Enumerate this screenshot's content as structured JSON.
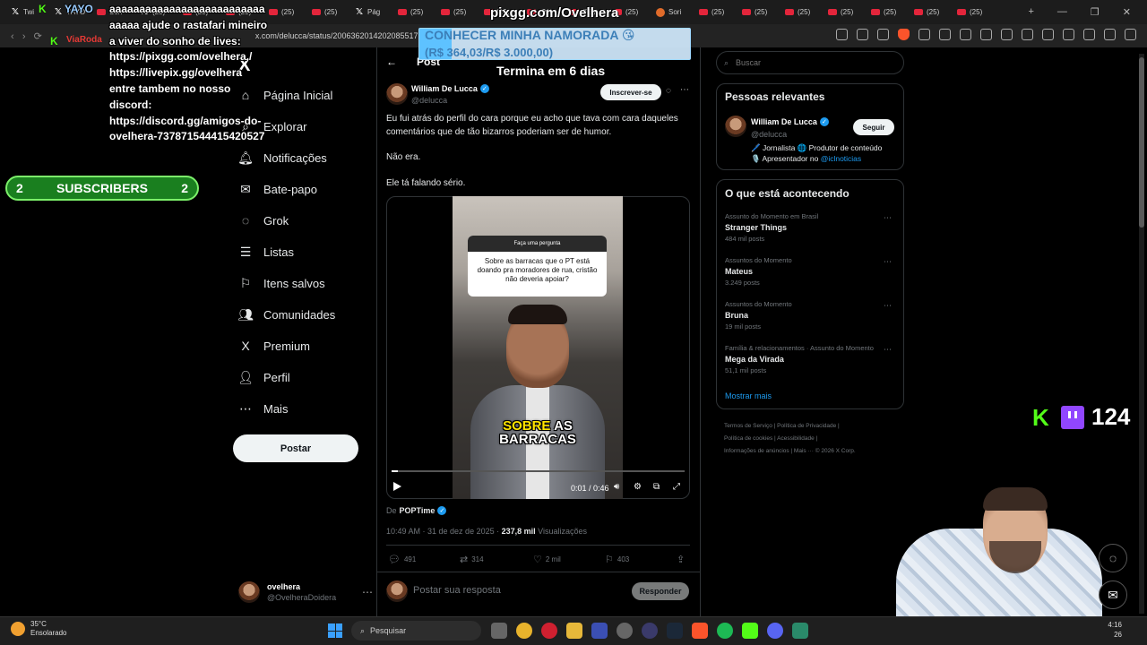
{
  "browser": {
    "tabs": [
      {
        "label": "Twi",
        "icon": "x"
      },
      {
        "label": "YAYO",
        "icon": "x"
      },
      {
        "label": "Sori",
        "icon": "yt"
      },
      {
        "label": "(25)",
        "icon": "x"
      },
      {
        "label": "(25)",
        "icon": "yt"
      },
      {
        "label": "(25)",
        "icon": "yt"
      },
      {
        "label": "(25)",
        "icon": "yt"
      },
      {
        "label": "(25)",
        "icon": "yt"
      },
      {
        "label": "Pág",
        "icon": "x"
      },
      {
        "label": "(25)",
        "icon": "yt"
      },
      {
        "label": "(25)",
        "icon": "yt"
      },
      {
        "label": "(25)",
        "icon": "yt"
      },
      {
        "label": "(25)",
        "icon": "yt"
      },
      {
        "label": "(25)",
        "icon": "yt"
      },
      {
        "label": "(25)",
        "icon": "yt"
      },
      {
        "label": "Sori",
        "icon": "s"
      },
      {
        "label": "(25)",
        "icon": "yt"
      },
      {
        "label": "(25)",
        "icon": "yt"
      },
      {
        "label": "(25)",
        "icon": "yt"
      },
      {
        "label": "(25)",
        "icon": "yt"
      },
      {
        "label": "(25)",
        "icon": "yt"
      },
      {
        "label": "(25)",
        "icon": "yt"
      },
      {
        "label": "(25)",
        "icon": "yt"
      }
    ],
    "url": "x.com/delucca/status/2006362014202085517"
  },
  "nav": {
    "logo": "X",
    "items": [
      {
        "label": "Página Inicial",
        "icon": "⌂",
        "name": "home"
      },
      {
        "label": "Explorar",
        "icon": "⌕",
        "name": "explore"
      },
      {
        "label": "Notificações",
        "icon": "🔔︎",
        "name": "notifications"
      },
      {
        "label": "Bate-papo",
        "icon": "✉",
        "name": "chat"
      },
      {
        "label": "Grok",
        "icon": "◌",
        "name": "grok"
      },
      {
        "label": "Listas",
        "icon": "☰",
        "name": "lists"
      },
      {
        "label": "Itens salvos",
        "icon": "⚐",
        "name": "bookmarks"
      },
      {
        "label": "Comunidades",
        "icon": "👥︎",
        "name": "communities"
      },
      {
        "label": "Premium",
        "icon": "X",
        "name": "premium"
      },
      {
        "label": "Perfil",
        "icon": "👤︎",
        "name": "profile"
      },
      {
        "label": "Mais",
        "icon": "⋯",
        "name": "more"
      }
    ],
    "post_button": "Postar",
    "account": {
      "name": "ovelhera",
      "handle": "@OvelheraDoidera"
    }
  },
  "post": {
    "header": "Post",
    "author": {
      "name": "William De Lucca",
      "handle": "@delucca"
    },
    "subscribe_button": "Inscrever-se",
    "paragraphs": [
      "Eu fui atrás do perfil do cara porque eu acho que tava com cara daqueles comentários que de tão bizarros poderiam ser de humor.",
      "Não era.",
      "Ele tá falando sério."
    ],
    "video": {
      "question_header": "Faça uma pergunta",
      "question_text": "Sobre as barracas que o PT está doando pra moradores de rua, cristão não deveria apoiar?",
      "caption_word1": "SOBRE",
      "caption_word2": "AS",
      "caption_word3": "BARRACAS",
      "time": "0:01 / 0:46",
      "progress": 0.02
    },
    "from_label": "De",
    "from_source": "POPTime",
    "timestamp": "10:49 AM · 31 de dez de 2025 · ",
    "views_count": "237,8 mil",
    "views_label": " Visualizações",
    "actions": {
      "replies": "491",
      "reposts": "314",
      "likes": "2 mil",
      "bookmarks": "403"
    },
    "reply_placeholder": "Postar sua resposta",
    "reply_button": "Responder"
  },
  "sidebar": {
    "search_placeholder": "Buscar",
    "relevant": {
      "title": "Pessoas relevantes",
      "name": "William De Lucca",
      "handle": "@delucca",
      "follow_button": "Seguir",
      "bio_line1": "🖊️ Jornalista 🌐 Produtor de conteúdo",
      "bio_line2_prefix": "🎙️ Apresentador no ",
      "bio_link": "@iclnoticias"
    },
    "trending": {
      "title": "O que está acontecendo",
      "items": [
        {
          "category": "Assunto do Momento em Brasil",
          "topic": "Stranger Things",
          "count": "484 mil posts"
        },
        {
          "category": "Assuntos do Momento",
          "topic": "Mateus",
          "count": "3.249 posts"
        },
        {
          "category": "Assuntos do Momento",
          "topic": "Bruna",
          "count": "19 mil posts"
        },
        {
          "category": "Família & relacionamentos · Assunto do Momento",
          "topic": "Mega da Virada",
          "count": "51,1 mil posts"
        }
      ],
      "show_more": "Mostrar mais"
    },
    "footer": {
      "line1": "Termos de Serviço  |  Política de Privacidade  |",
      "line2": "Política de cookies  |  Acessibilidade  |",
      "line3": "Informações de anúncios  |  Mais ···  © 2026 X Corp."
    }
  },
  "overlay": {
    "chat_kick_user": "YAYO",
    "chat_message": "aaaaaaaaaaaaaaaaaaaaaaaaaaaaaaa ajude o rastafari mineiro a viver do sonho de lives: https://pixgg.com/ovelhera / https://livepix.gg/ovelhera entre tambem no nosso discord: https://discord.gg/amigos-do-ovelhera-737871544415420527",
    "chat_user2": "ViaRoda",
    "subscribers_left": "2",
    "subscribers_label": "SUBSCRIBERS",
    "subscribers_right": "2",
    "pix_title": "pixgg.com/Ovelhera",
    "goal_title": "CONHECER MINHA NAMORADA 😘",
    "goal_amount": "(R$ 364,03/R$ 3.000,00)",
    "goal_progress": 0.12,
    "goal_ends": "Termina em 6 dias",
    "viewer_count": "124"
  },
  "taskbar": {
    "temperature": "35°C",
    "weather": "Ensolarado",
    "search_placeholder": "Pesquisar",
    "time": "4:16",
    "date": "26"
  }
}
